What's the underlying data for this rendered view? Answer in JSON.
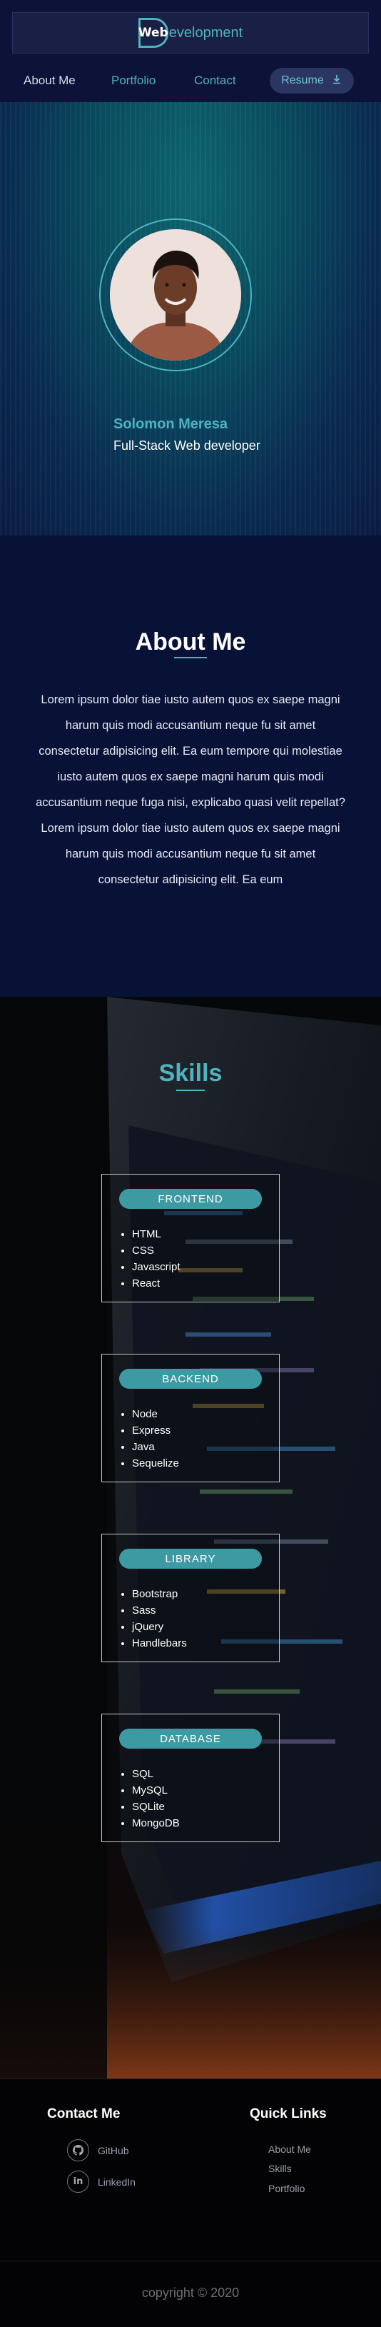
{
  "brand": {
    "badge_text": "Web",
    "rest_text": "evelopment",
    "accent": "#4fb3bf"
  },
  "nav": {
    "items": [
      {
        "label": "About Me"
      },
      {
        "label": "Portfolio"
      },
      {
        "label": "Contact"
      }
    ],
    "resume_label": "Resume",
    "resume_icon": "download-icon"
  },
  "hero": {
    "name": "Solomon Meresa",
    "title": "Full-Stack Web developer"
  },
  "about": {
    "heading": "About Me",
    "text": "Lorem ipsum dolor tiae iusto autem quos ex saepe magni harum quis modi accusantium neque fu sit amet consectetur adipisicing elit. Ea eum tempore qui molestiae iusto autem quos ex saepe magni harum quis modi accusantium neque fuga nisi, explicabo quasi velit repellat? Lorem ipsum dolor tiae iusto autem quos ex saepe magni harum quis modi accusantium neque fu sit amet consectetur adipisicing elit. Ea eum"
  },
  "skills": {
    "heading": "Skills",
    "cards": [
      {
        "title": "FRONTEND",
        "items": [
          "HTML",
          "CSS",
          "Javascript",
          "React"
        ]
      },
      {
        "title": "BACKEND",
        "items": [
          "Node",
          "Express",
          "Java",
          "Sequelize"
        ]
      },
      {
        "title": "LIBRARY",
        "items": [
          "Bootstrap",
          "Sass",
          "jQuery",
          "Handlebars"
        ]
      },
      {
        "title": "DATABASE",
        "items": [
          "SQL",
          "MySQL",
          "SQLite",
          "MongoDB"
        ]
      }
    ]
  },
  "footer": {
    "contact_heading": "Contact Me",
    "contact_links": [
      {
        "label": "GitHub",
        "icon": "github-icon"
      },
      {
        "label": "LinkedIn",
        "icon": "linkedin-icon"
      }
    ],
    "quick_heading": "Quick Links",
    "quick_links": [
      "About Me",
      "Skills",
      "Portfolio"
    ],
    "copyright": "copyright © 2020"
  }
}
